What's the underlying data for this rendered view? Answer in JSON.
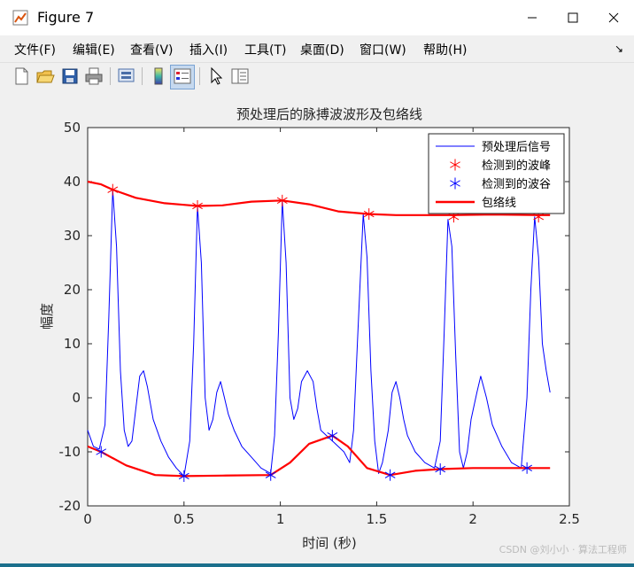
{
  "window": {
    "title": "Figure 7"
  },
  "menu": [
    "文件(F)",
    "编辑(E)",
    "查看(V)",
    "插入(I)",
    "工具(T)",
    "桌面(D)",
    "窗口(W)",
    "帮助(H)"
  ],
  "toolbar_icons": [
    "new-figure-icon",
    "open-file-icon",
    "save-icon",
    "print-icon",
    "print-preview-icon",
    "colorbar-icon",
    "legend-icon",
    "pointer-icon",
    "property-editor-icon"
  ],
  "watermark": "CSDN @刘小小 · 算法工程师",
  "colors": {
    "signal": "#0000ff",
    "peaks": "#ff0000",
    "troughs": "#0000ff",
    "envelope": "#ff0000"
  },
  "chart_data": {
    "type": "line",
    "title": "预处理后的脉搏波波形及包络线",
    "xlabel": "时间 (秒)",
    "ylabel": "幅度",
    "xlim": [
      0,
      2.5
    ],
    "ylim": [
      -20,
      50
    ],
    "xticks": [
      "0",
      "0.5",
      "1",
      "1.5",
      "2",
      "2.5"
    ],
    "yticks": [
      "-20",
      "-10",
      "0",
      "10",
      "20",
      "30",
      "40",
      "50"
    ],
    "grid": false,
    "legend": {
      "position": "top-right",
      "entries": [
        "预处理后信号",
        "检测到的波峰",
        "检测到的波谷",
        "包络线"
      ]
    },
    "series": [
      {
        "name": "预处理后信号",
        "x": [
          0,
          0.03,
          0.06,
          0.09,
          0.11,
          0.13,
          0.15,
          0.17,
          0.19,
          0.21,
          0.23,
          0.25,
          0.27,
          0.29,
          0.31,
          0.34,
          0.38,
          0.42,
          0.46,
          0.5,
          0.53,
          0.55,
          0.57,
          0.59,
          0.61,
          0.63,
          0.65,
          0.67,
          0.69,
          0.71,
          0.73,
          0.76,
          0.8,
          0.85,
          0.9,
          0.95,
          0.97,
          0.99,
          1.01,
          1.03,
          1.05,
          1.07,
          1.09,
          1.11,
          1.14,
          1.17,
          1.19,
          1.21,
          1.24,
          1.27,
          1.3,
          1.33,
          1.36,
          1.38,
          1.4,
          1.43,
          1.45,
          1.47,
          1.49,
          1.51,
          1.53,
          1.56,
          1.58,
          1.6,
          1.62,
          1.64,
          1.66,
          1.7,
          1.75,
          1.8,
          1.83,
          1.85,
          1.87,
          1.89,
          1.91,
          1.93,
          1.95,
          1.97,
          1.99,
          2.02,
          2.04,
          2.07,
          2.1,
          2.15,
          2.2,
          2.25,
          2.28,
          2.3,
          2.32,
          2.34,
          2.36,
          2.38,
          2.4
        ],
        "y": [
          -6,
          -9,
          -9.5,
          -5,
          15,
          38.5,
          28,
          5,
          -6,
          -9,
          -8,
          -2,
          4,
          5,
          2,
          -4,
          -8,
          -11,
          -13,
          -14.5,
          -8,
          10,
          35.5,
          25,
          0,
          -6,
          -4,
          1,
          3,
          0,
          -3,
          -6,
          -9,
          -11,
          -13,
          -14,
          -7,
          12,
          36.5,
          25,
          0,
          -4,
          -2,
          3,
          5,
          3,
          -2,
          -6,
          -7,
          -8,
          -9,
          -10,
          -12,
          -6,
          10,
          34,
          26,
          5,
          -8,
          -14,
          -12,
          -6,
          1,
          3,
          0,
          -4,
          -7,
          -10,
          -12,
          -13,
          -8,
          12,
          33,
          28,
          8,
          -10,
          -13,
          -10,
          -4,
          1,
          4,
          0,
          -5,
          -9,
          -12,
          -13,
          0,
          20,
          33.5,
          26,
          10,
          5,
          1
        ]
      },
      {
        "name": "检测到的波峰",
        "marker": "asterisk",
        "x": [
          0.13,
          0.57,
          1.01,
          1.46,
          1.9,
          2.34
        ],
        "y": [
          38.5,
          35.5,
          36.5,
          34,
          33.5,
          33.5
        ]
      },
      {
        "name": "检测到的波谷",
        "marker": "asterisk",
        "x": [
          0.07,
          0.5,
          0.95,
          1.27,
          1.57,
          1.83,
          2.28
        ],
        "y": [
          -10,
          -14.5,
          -14.3,
          -7,
          -14.3,
          -13.2,
          -13
        ]
      },
      {
        "name": "包络线",
        "x": [
          0,
          0.07,
          0.13,
          0.25,
          0.4,
          0.5,
          0.57,
          0.7,
          0.85,
          1.01,
          1.15,
          1.3,
          1.46,
          1.6,
          1.9,
          2.1,
          2.34,
          2.4
        ],
        "y": [
          40,
          39.5,
          38.5,
          37,
          36,
          35.7,
          35.5,
          35.6,
          36.3,
          36.5,
          35.8,
          34.5,
          34,
          33.8,
          33.8,
          33.9,
          33.8,
          33.8
        ]
      },
      {
        "name": "包络线",
        "x": [
          0,
          0.07,
          0.2,
          0.35,
          0.5,
          0.7,
          0.95,
          1.05,
          1.15,
          1.27,
          1.35,
          1.45,
          1.57,
          1.7,
          1.83,
          2.0,
          2.28,
          2.4
        ],
        "y": [
          -9,
          -10,
          -12.5,
          -14.3,
          -14.5,
          -14.4,
          -14.3,
          -12,
          -8.5,
          -7,
          -9,
          -13,
          -14.3,
          -13.5,
          -13.2,
          -13,
          -13,
          -13
        ]
      }
    ]
  }
}
